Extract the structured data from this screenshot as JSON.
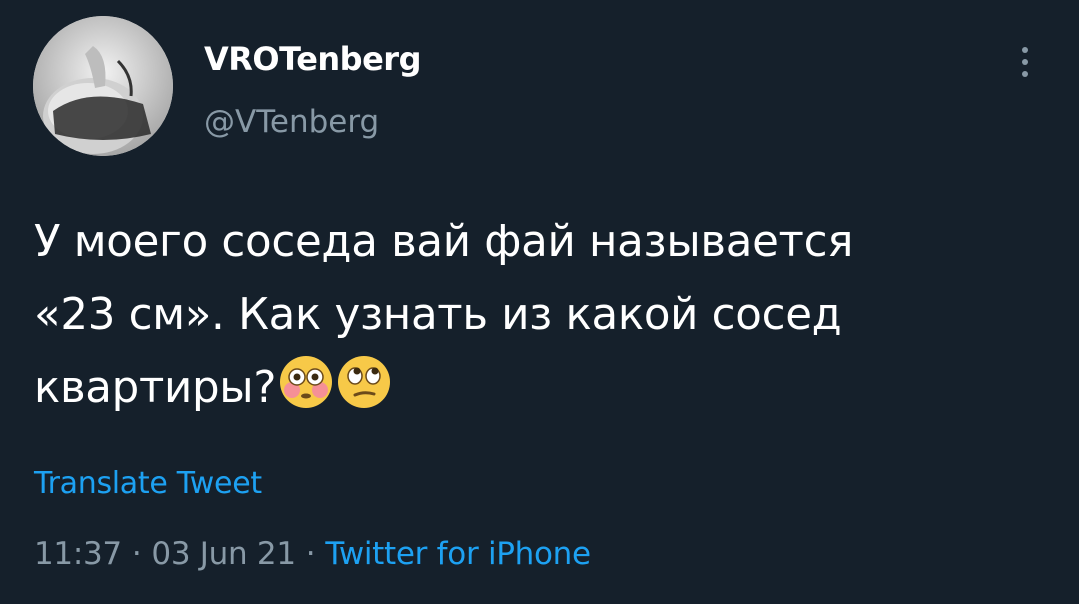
{
  "author": {
    "display_name": "VROTenberg",
    "handle": "@VTenberg"
  },
  "tweet": {
    "lines": [
      "У моего соседа вай фай называется",
      "«23 см». Как узнать из какой сосед",
      "квартиры?"
    ],
    "emojis": [
      "flushed-face-emoji",
      "face-with-rolling-eyes-emoji"
    ]
  },
  "translate_label": "Translate Tweet",
  "meta": {
    "time": "11:37",
    "separator": "·",
    "date": "03 Jun 21",
    "source": "Twitter for iPhone"
  },
  "colors": {
    "background": "#15202b",
    "text": "#ffffff",
    "secondary": "#8899a6",
    "accent": "#1da1f2"
  }
}
